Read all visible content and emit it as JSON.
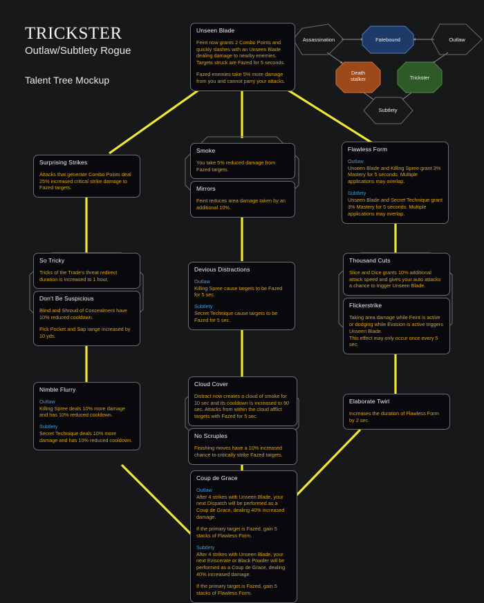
{
  "page": {
    "background": "#17181a",
    "wire_color": "#f2e832",
    "frame_color": "#6d6d74",
    "body_text_color": "#d9a521",
    "title_text_color": "#f3f3f3",
    "spec_head_color": "#3f9fe0"
  },
  "header": {
    "title": "TRICKSTER",
    "subtitle": "Outlaw/Subtlety Rogue",
    "note": "Talent Tree Mockup"
  },
  "spec_diagram": {
    "nodes": [
      {
        "id": "assassination",
        "label": "Assassination",
        "color": "transparent",
        "border": "#6d6d74"
      },
      {
        "id": "fatebound",
        "label": "Fatebound",
        "color": "#1e3a68",
        "border": "#4a6fa5"
      },
      {
        "id": "outlaw",
        "label": "Outlaw",
        "color": "transparent",
        "border": "#6d6d74"
      },
      {
        "id": "deathstalker",
        "label": "Death\nstalker",
        "label_line1": "Death",
        "label_line2": "stalker",
        "color": "#9c4a1c",
        "border": "#c46a33"
      },
      {
        "id": "trickster",
        "label": "Trickster",
        "color": "#2d5a27",
        "border": "#4a7d42"
      },
      {
        "id": "subtlety",
        "label": "Subtlety",
        "color": "transparent",
        "border": "#6d6d74"
      }
    ],
    "arrows": [
      {
        "from": "assassination",
        "to": "fatebound"
      },
      {
        "from": "outlaw",
        "to": "fatebound"
      },
      {
        "from": "assassination",
        "to": "deathstalker"
      },
      {
        "from": "outlaw",
        "to": "trickster"
      },
      {
        "from": "subtlety",
        "to": "deathstalker"
      },
      {
        "from": "subtlety",
        "to": "trickster"
      }
    ]
  },
  "talents": [
    {
      "id": "unseen-blade",
      "tips": [
        {
          "title": "Unseen Blade",
          "paragraphs": [
            {
              "text": "Feint now grants 2 Combo Points and quickly slashes with an Unseen Blade dealing damage to nearby enemies. Targets struck are Fazed for 5 seconds."
            },
            {
              "text": "Fazed enemies take 5% more damage from you and cannot parry your attacks."
            }
          ]
        }
      ]
    },
    {
      "id": "surprising-strikes",
      "tips": [
        {
          "title": "Surprising Strikes",
          "paragraphs": [
            {
              "text": "Attacks that generate Combo Points deal 25% increased critical strike damage to Fazed targets."
            }
          ]
        }
      ]
    },
    {
      "id": "smoke-mirrors",
      "tips": [
        {
          "title": "Smoke",
          "paragraphs": [
            {
              "text": "You take 5% reduced damage from Fazed targets."
            }
          ]
        },
        {
          "title": "Mirrors",
          "paragraphs": [
            {
              "text": "Feint reduces area damage taken by an additional 10%."
            }
          ]
        }
      ]
    },
    {
      "id": "flawless-form",
      "tips": [
        {
          "title": "Flawless Form",
          "paragraphs": [
            {
              "head": "Outlaw",
              "text": "Unseen Blade and Killing Spree grant 3% Mastery for 5 seconds. Multiple applications may overlap."
            },
            {
              "head": "Subtlety",
              "text": "Unseen Blade and Secret Technique grant 3% Mastery for 5 seconds. Multiple applications may overlap."
            }
          ]
        }
      ]
    },
    {
      "id": "so-tricky",
      "tips": [
        {
          "title": "So Tricky",
          "paragraphs": [
            {
              "text": "Tricks of the Trade's threat redirect duration is increased to 1 hour."
            }
          ]
        },
        {
          "title": "Don't Be Suspicious",
          "paragraphs": [
            {
              "text": "Blind and Shroud of Concealment have 10% reduced cooldown."
            },
            {
              "text": "Pick Pocket and Sap range increased by 10 yds."
            }
          ]
        }
      ]
    },
    {
      "id": "devious-distractions",
      "tips": [
        {
          "title": "Devious Distractions",
          "paragraphs": [
            {
              "head": "Outlaw",
              "text": "Killing Spree cause targets to be Fazed for 5 sec."
            },
            {
              "head": "Subtlety",
              "text": "Secret Technique cause targets to be Fazed for 5 sec."
            }
          ]
        }
      ]
    },
    {
      "id": "thousand-cuts",
      "tips": [
        {
          "title": "Thousand Cuts",
          "paragraphs": [
            {
              "text": "Slice and Dice grants 10% additional attack speed and gives your auto attacks a chance to trigger Unseen Blade."
            }
          ]
        },
        {
          "title": "Flickerstrike",
          "paragraphs": [
            {
              "text": "Taking area damage while Feint is active or dodging while Evasion is active triggers Unseen Blade.\nThis effect may only occur once every 5 sec."
            }
          ]
        }
      ]
    },
    {
      "id": "nimble-flurry",
      "tips": [
        {
          "title": "Nimble Flurry",
          "paragraphs": [
            {
              "head": "Outlaw",
              "text": "Killing Spree deals 10% more damage and has 10% reduced cooldown."
            },
            {
              "head": "Subtlety",
              "text": "Secret Technique deals 10% more damage and has 10% reduced cooldown."
            }
          ]
        }
      ]
    },
    {
      "id": "cloud-cover",
      "tips": [
        {
          "title": "Cloud Cover",
          "paragraphs": [
            {
              "text": "Distract now creates a cloud of smoke for 10 sec and its cooldown is increased to 90 sec. Attacks from within the cloud afflict targets with Fazed for 5 sec."
            }
          ]
        },
        {
          "title": "No Scruples",
          "paragraphs": [
            {
              "text": "Finishing moves have a 10% increased chance to critically strike Fazed targets."
            }
          ]
        }
      ]
    },
    {
      "id": "elaborate-twirl",
      "tips": [
        {
          "title": "Elaborate Twirl",
          "paragraphs": [
            {
              "text": "Increases the duration of Flawless Form by 2 sec."
            }
          ]
        }
      ]
    },
    {
      "id": "coup-de-grace",
      "tips": [
        {
          "title": "Coup de Grace",
          "paragraphs": [
            {
              "head": "Outlaw",
              "text": "After 4 strikes with Unseen Blade, your next Dispatch will be performed as a Coup de Grace, dealing 40% increased damage."
            },
            {
              "text": "If the primary target is Fazed, gain 5 stacks of Flawless Form."
            },
            {
              "head": "Subtlety",
              "text": "After 4 strikes with Unseen Blade, your next Eviscerate or Black Powder will be performed as a Coup de Grace, dealing 40% increased damage."
            },
            {
              "text": "If the primary target is Fazed, gain 5 stacks of Flawless Form."
            }
          ]
        }
      ]
    }
  ]
}
